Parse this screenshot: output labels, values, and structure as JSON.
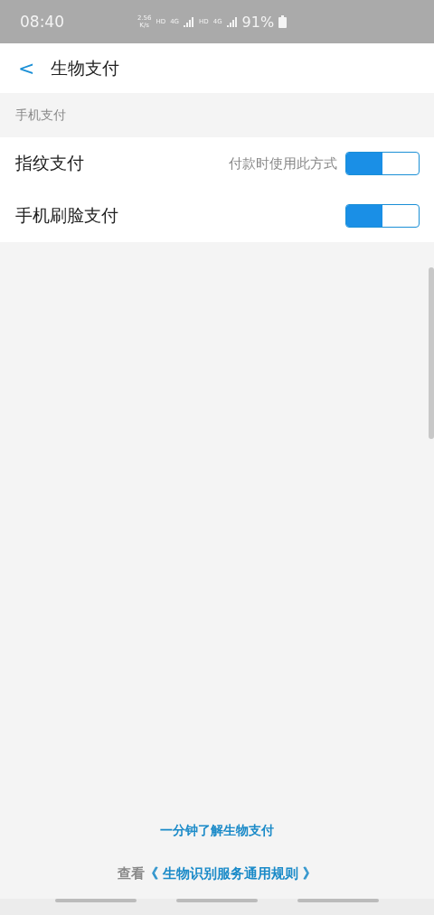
{
  "status_bar": {
    "time": "08:40",
    "speed": [
      "2.56",
      "K/s"
    ],
    "network": [
      "HD",
      "4G",
      "HD",
      "4G"
    ],
    "battery": "91%"
  },
  "header": {
    "back": "<",
    "title": "生物支付"
  },
  "section": {
    "label": "手机支付"
  },
  "settings": [
    {
      "label": "指纹支付",
      "hint": "付款时使用此方式",
      "on": true
    },
    {
      "label": "手机刷脸支付",
      "on": true
    }
  ],
  "footer": {
    "link": "一分钟了解生物支付",
    "rules_prefix": "查看",
    "rules_link": "《 生物识别服务通用规则 》"
  }
}
